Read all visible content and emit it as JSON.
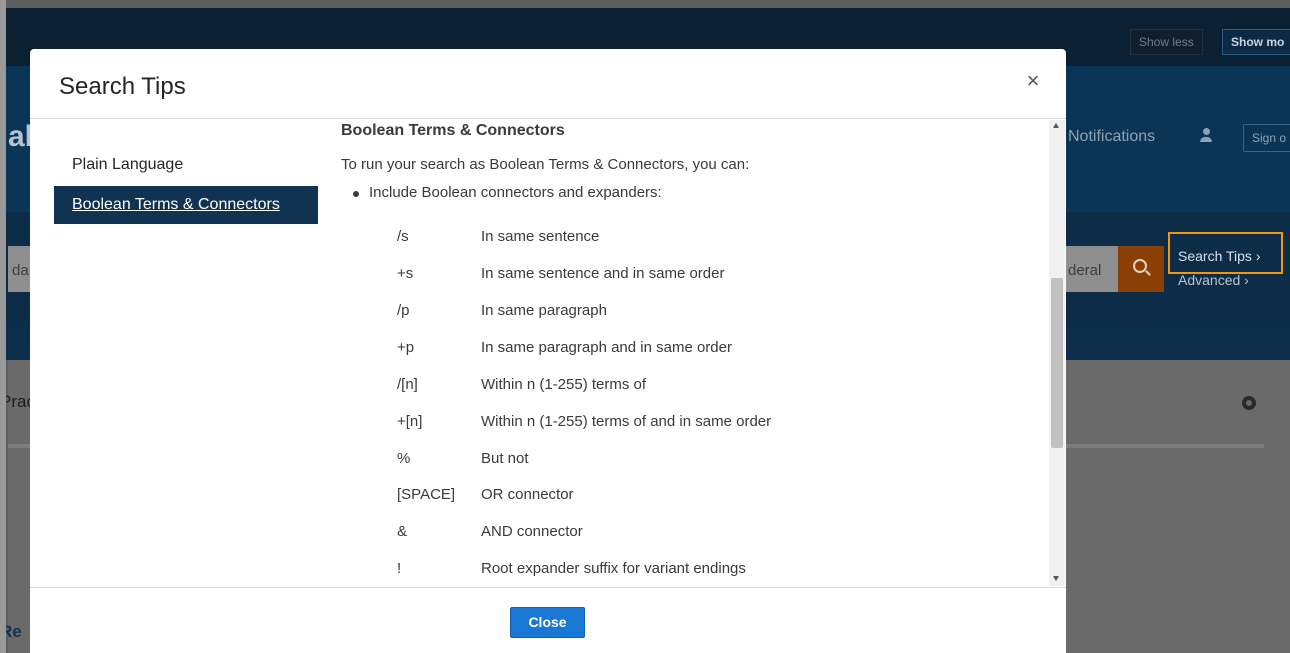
{
  "background": {
    "show_less": "Show less",
    "show_more": "Show mo",
    "brand_fragment": "al",
    "notifications": "Notifications",
    "sign_on": "Sign o",
    "search_value": "da",
    "jurisdiction": "deral",
    "search_tips_link": "Search Tips ›",
    "advanced_link": "Advanced ›",
    "practice_fragment": "Prac",
    "re_fragment": "Re"
  },
  "modal": {
    "title": "Search Tips",
    "close_icon_glyph": "×",
    "sidebar": [
      {
        "label": "Plain Language",
        "active": false
      },
      {
        "label": "Boolean Terms & Connectors",
        "active": true
      }
    ],
    "section": {
      "heading": "Boolean Terms & Connectors",
      "intro": "To run your search as Boolean Terms & Connectors, you can:",
      "bullet": "Include Boolean connectors and expanders:",
      "connectors": [
        {
          "symbol": "/s",
          "description": "In same sentence"
        },
        {
          "symbol": "+s",
          "description": "In same sentence and in same order"
        },
        {
          "symbol": "/p",
          "description": "In same paragraph"
        },
        {
          "symbol": "+p",
          "description": "In same paragraph and in same order"
        },
        {
          "symbol": "/[n]",
          "description": "Within n (1-255) terms of"
        },
        {
          "symbol": "+[n]",
          "description": "Within n (1-255) terms of and in same order"
        },
        {
          "symbol": "%",
          "description": "But not"
        },
        {
          "symbol": "[SPACE]",
          "description": "OR connector"
        },
        {
          "symbol": "&",
          "description": "AND connector"
        },
        {
          "symbol": "!",
          "description": "Root expander suffix for variant endings"
        }
      ]
    },
    "footer": {
      "close_label": "Close"
    }
  },
  "colors": {
    "overlay": "#5f5f5f",
    "modal_bg": "#ffffff",
    "active_item_bg": "#0f3350",
    "primary_button": "#1a77d4",
    "highlight_outline": "#f0960f"
  }
}
